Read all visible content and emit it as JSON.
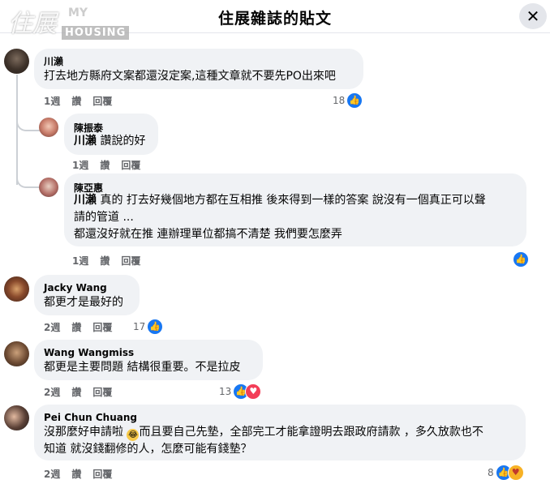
{
  "header": {
    "title": "住展雜誌的貼文",
    "close_icon": "close-icon"
  },
  "watermark": {
    "glyph": "住展",
    "my": "MY",
    "housing": "HOUSING"
  },
  "actions": {
    "like": "讚",
    "reply": "回覆"
  },
  "comments": [
    {
      "name": "川瀨",
      "text": "打去地方縣府文案都還沒定案,這種文章就不要先PO出來吧",
      "time": "1週",
      "reactions": {
        "count": "18",
        "types": [
          "like"
        ]
      }
    },
    {
      "name": "陳振泰",
      "mention": "川瀨",
      "text": "讚說的好",
      "time": "1週"
    },
    {
      "name": "陳亞惠",
      "mention": "川瀨",
      "text_line1": "真的  打去好幾個地方都在互相推  後來得到一樣的答案  說沒有一個真正可以聲",
      "text_line2": "請的管道 ...",
      "text_line3": "都還沒好就在推  連辦理單位都搞不清楚  我們要怎麼弄",
      "time": "1週",
      "reactions": {
        "count": "",
        "types": [
          "like"
        ]
      }
    },
    {
      "name": "Jacky Wang",
      "text": "都更才是最好的",
      "time": "2週",
      "reactions": {
        "count": "17",
        "types": [
          "like"
        ]
      }
    },
    {
      "name": "Wang Wangmiss",
      "text": "都更是主要問題  結構很重要。不是拉皮",
      "time": "2週",
      "reactions": {
        "count": "13",
        "types": [
          "like",
          "love"
        ]
      }
    },
    {
      "name": "Pei Chun Chuang",
      "text_line1a": "沒那麼好申請啦 ",
      "text_line1b": "而且要自己先墊，全部完工才能拿證明去跟政府請款 ，多久放款也不",
      "text_line2": "知道  就沒錢翻修的人，怎麼可能有錢墊？",
      "time": "2週",
      "reactions": {
        "count": "8",
        "types": [
          "like",
          "care"
        ]
      }
    }
  ]
}
